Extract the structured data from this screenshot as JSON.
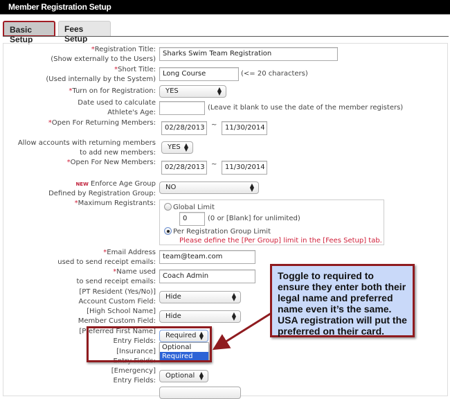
{
  "header": {
    "title": "Member Registration Setup"
  },
  "tabs": [
    {
      "label": "Basic Setup",
      "active": true
    },
    {
      "label": "Fees Setup",
      "active": false
    }
  ],
  "form": {
    "registration_title": {
      "label": "Registration Title:",
      "sub": "(Show externally to the Users)",
      "value": "Sharks Swim Team Registration"
    },
    "short_title": {
      "label": "Short Title:",
      "sub": "(Used internally by the System)",
      "value": "Long Course",
      "hint": "(<= 20 characters)"
    },
    "turn_on": {
      "label": "Turn on for Registration:",
      "value": "YES"
    },
    "age_date": {
      "label1": "Date used to calculate",
      "label2": "Athlete's Age:",
      "value": "",
      "hint": "(Leave it blank to use the date of the member registers)"
    },
    "open_returning": {
      "label": "Open For Returning Members:",
      "from": "02/28/2013",
      "sep": "~",
      "to": "11/30/2014"
    },
    "allow_accounts": {
      "label1": "Allow accounts with returning members",
      "label2": "to add new members:",
      "value": "YES"
    },
    "open_new": {
      "label": "Open For New Members:",
      "from": "02/28/2013",
      "sep": "~",
      "to": "11/30/2014"
    },
    "enforce_age": {
      "badge": "NEW",
      "label1": "Enforce Age Group",
      "label2": "Defined by Registration Group:",
      "value": "NO"
    },
    "max_registrants": {
      "label": "Maximum Registrants:",
      "global_label": "Global Limit",
      "global_value": "0",
      "global_hint": "(0 or [Blank] for unlimited)",
      "per_group_label": "Per Registration Group Limit",
      "per_group_note": "Please define the [Per Group] limit in the [Fees Setup] tab.",
      "selected": "per_group"
    },
    "email": {
      "label1": "Email Address",
      "label2": "used to send receipt emails:",
      "value": "team@team.com"
    },
    "name_used": {
      "label1": "Name used",
      "label2": "to send receipt emails:",
      "value": "Coach Admin"
    },
    "pt_resident": {
      "label1": "[PT Resident (Yes/No)]",
      "label2": "Account Custom Field:",
      "value": "Hide"
    },
    "high_school": {
      "label1": "[High School Name]",
      "label2": "Member Custom Field:",
      "value": "Hide"
    },
    "preferred_first": {
      "label1": "[Preferred First Name]",
      "label2": "Entry Fields:",
      "value": "Required",
      "options": [
        "Optional",
        "Required"
      ]
    },
    "insurance": {
      "label1": "[Insurance]",
      "label2": "Entry Fields:"
    },
    "emergency": {
      "label1": "[Emergency]",
      "label2": "Entry Fields:",
      "value": "Optional"
    }
  },
  "callout": {
    "text": "Toggle to required to ensure they enter both their legal name and preferred name even it’s the same.  USA registration will put the preferred on their card."
  },
  "colors": {
    "required_star": "#d0203a",
    "highlight": "#8f1b1f",
    "callout_bg": "#c9d9f9",
    "selected_option": "#2d63d6"
  }
}
